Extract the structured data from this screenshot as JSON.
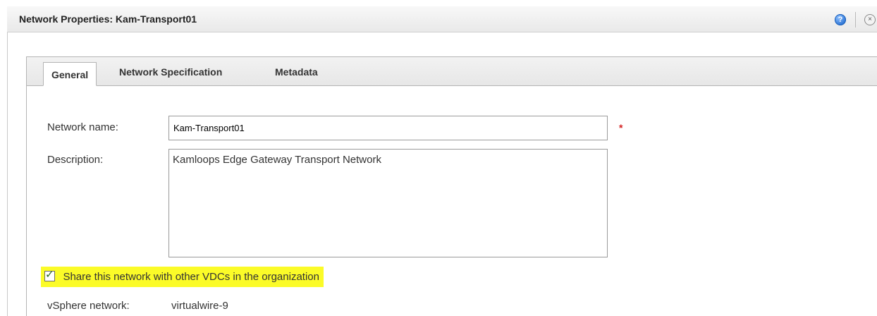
{
  "window": {
    "title": "Network Properties: Kam-Transport01",
    "help_glyph": "?",
    "close_glyph": "×"
  },
  "tabs": [
    {
      "label": "General",
      "active": true
    },
    {
      "label": "Network Specification",
      "active": false
    },
    {
      "label": "Metadata",
      "active": false
    }
  ],
  "form": {
    "network_name_label": "Network name:",
    "network_name_value": "Kam-Transport01",
    "required_marker": "*",
    "description_label": "Description:",
    "description_value": "Kamloops Edge Gateway Transport Network",
    "share_checkbox": {
      "checked": true,
      "check_glyph": "✓",
      "label": "Share this network with other VDCs in the organization",
      "highlight_color": "#fbfb28"
    },
    "vsphere_network_label": "vSphere network:",
    "vsphere_network_value": "virtualwire-9"
  },
  "icons": {
    "help": "help-icon",
    "close": "close-icon",
    "check": "checkmark-icon"
  },
  "colors": {
    "required": "#d42222",
    "help_icon": "#2f76d6"
  }
}
